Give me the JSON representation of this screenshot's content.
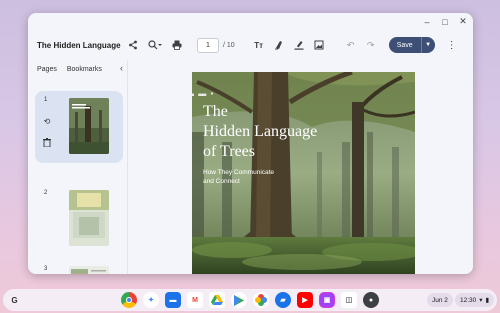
{
  "window": {
    "controls": [
      "–",
      "□",
      "✕"
    ]
  },
  "toolbar": {
    "title": "The Hidden Language of...",
    "page_current": "1",
    "page_total": "/ 10",
    "save_label": "Save"
  },
  "sidebar": {
    "tabs": [
      "Pages",
      "Bookmarks"
    ],
    "thumbnails": [
      {
        "number": "1",
        "selected": true
      },
      {
        "number": "2",
        "selected": false
      },
      {
        "number": "3",
        "selected": false
      }
    ]
  },
  "cover": {
    "title_line1": "The",
    "title_line2": "Hidden Language",
    "title_line3": "of Trees",
    "subtitle_line1": "How They Communicate",
    "subtitle_line2": "and Connect"
  },
  "shelf": {
    "date": "Jun 2",
    "time": "12:30",
    "apps": [
      {
        "name": "chrome-icon",
        "color": "#e94235"
      },
      {
        "name": "assistant-icon",
        "color": "#4285f4"
      },
      {
        "name": "files-icon",
        "color": "#1a73e8"
      },
      {
        "name": "gmail-icon",
        "color": "#ea4335"
      },
      {
        "name": "drive-icon",
        "color": "#34a853"
      },
      {
        "name": "play-store-icon",
        "color": "#01875f"
      },
      {
        "name": "photos-icon",
        "color": "#fbbc04"
      },
      {
        "name": "messages-icon",
        "color": "#1a73e8"
      },
      {
        "name": "youtube-icon",
        "color": "#ff0000"
      },
      {
        "name": "pdf-app-icon",
        "color": "#a142f4"
      },
      {
        "name": "gallery-icon",
        "color": "#5f6368"
      },
      {
        "name": "settings-icon",
        "color": "#3c4043"
      }
    ]
  }
}
